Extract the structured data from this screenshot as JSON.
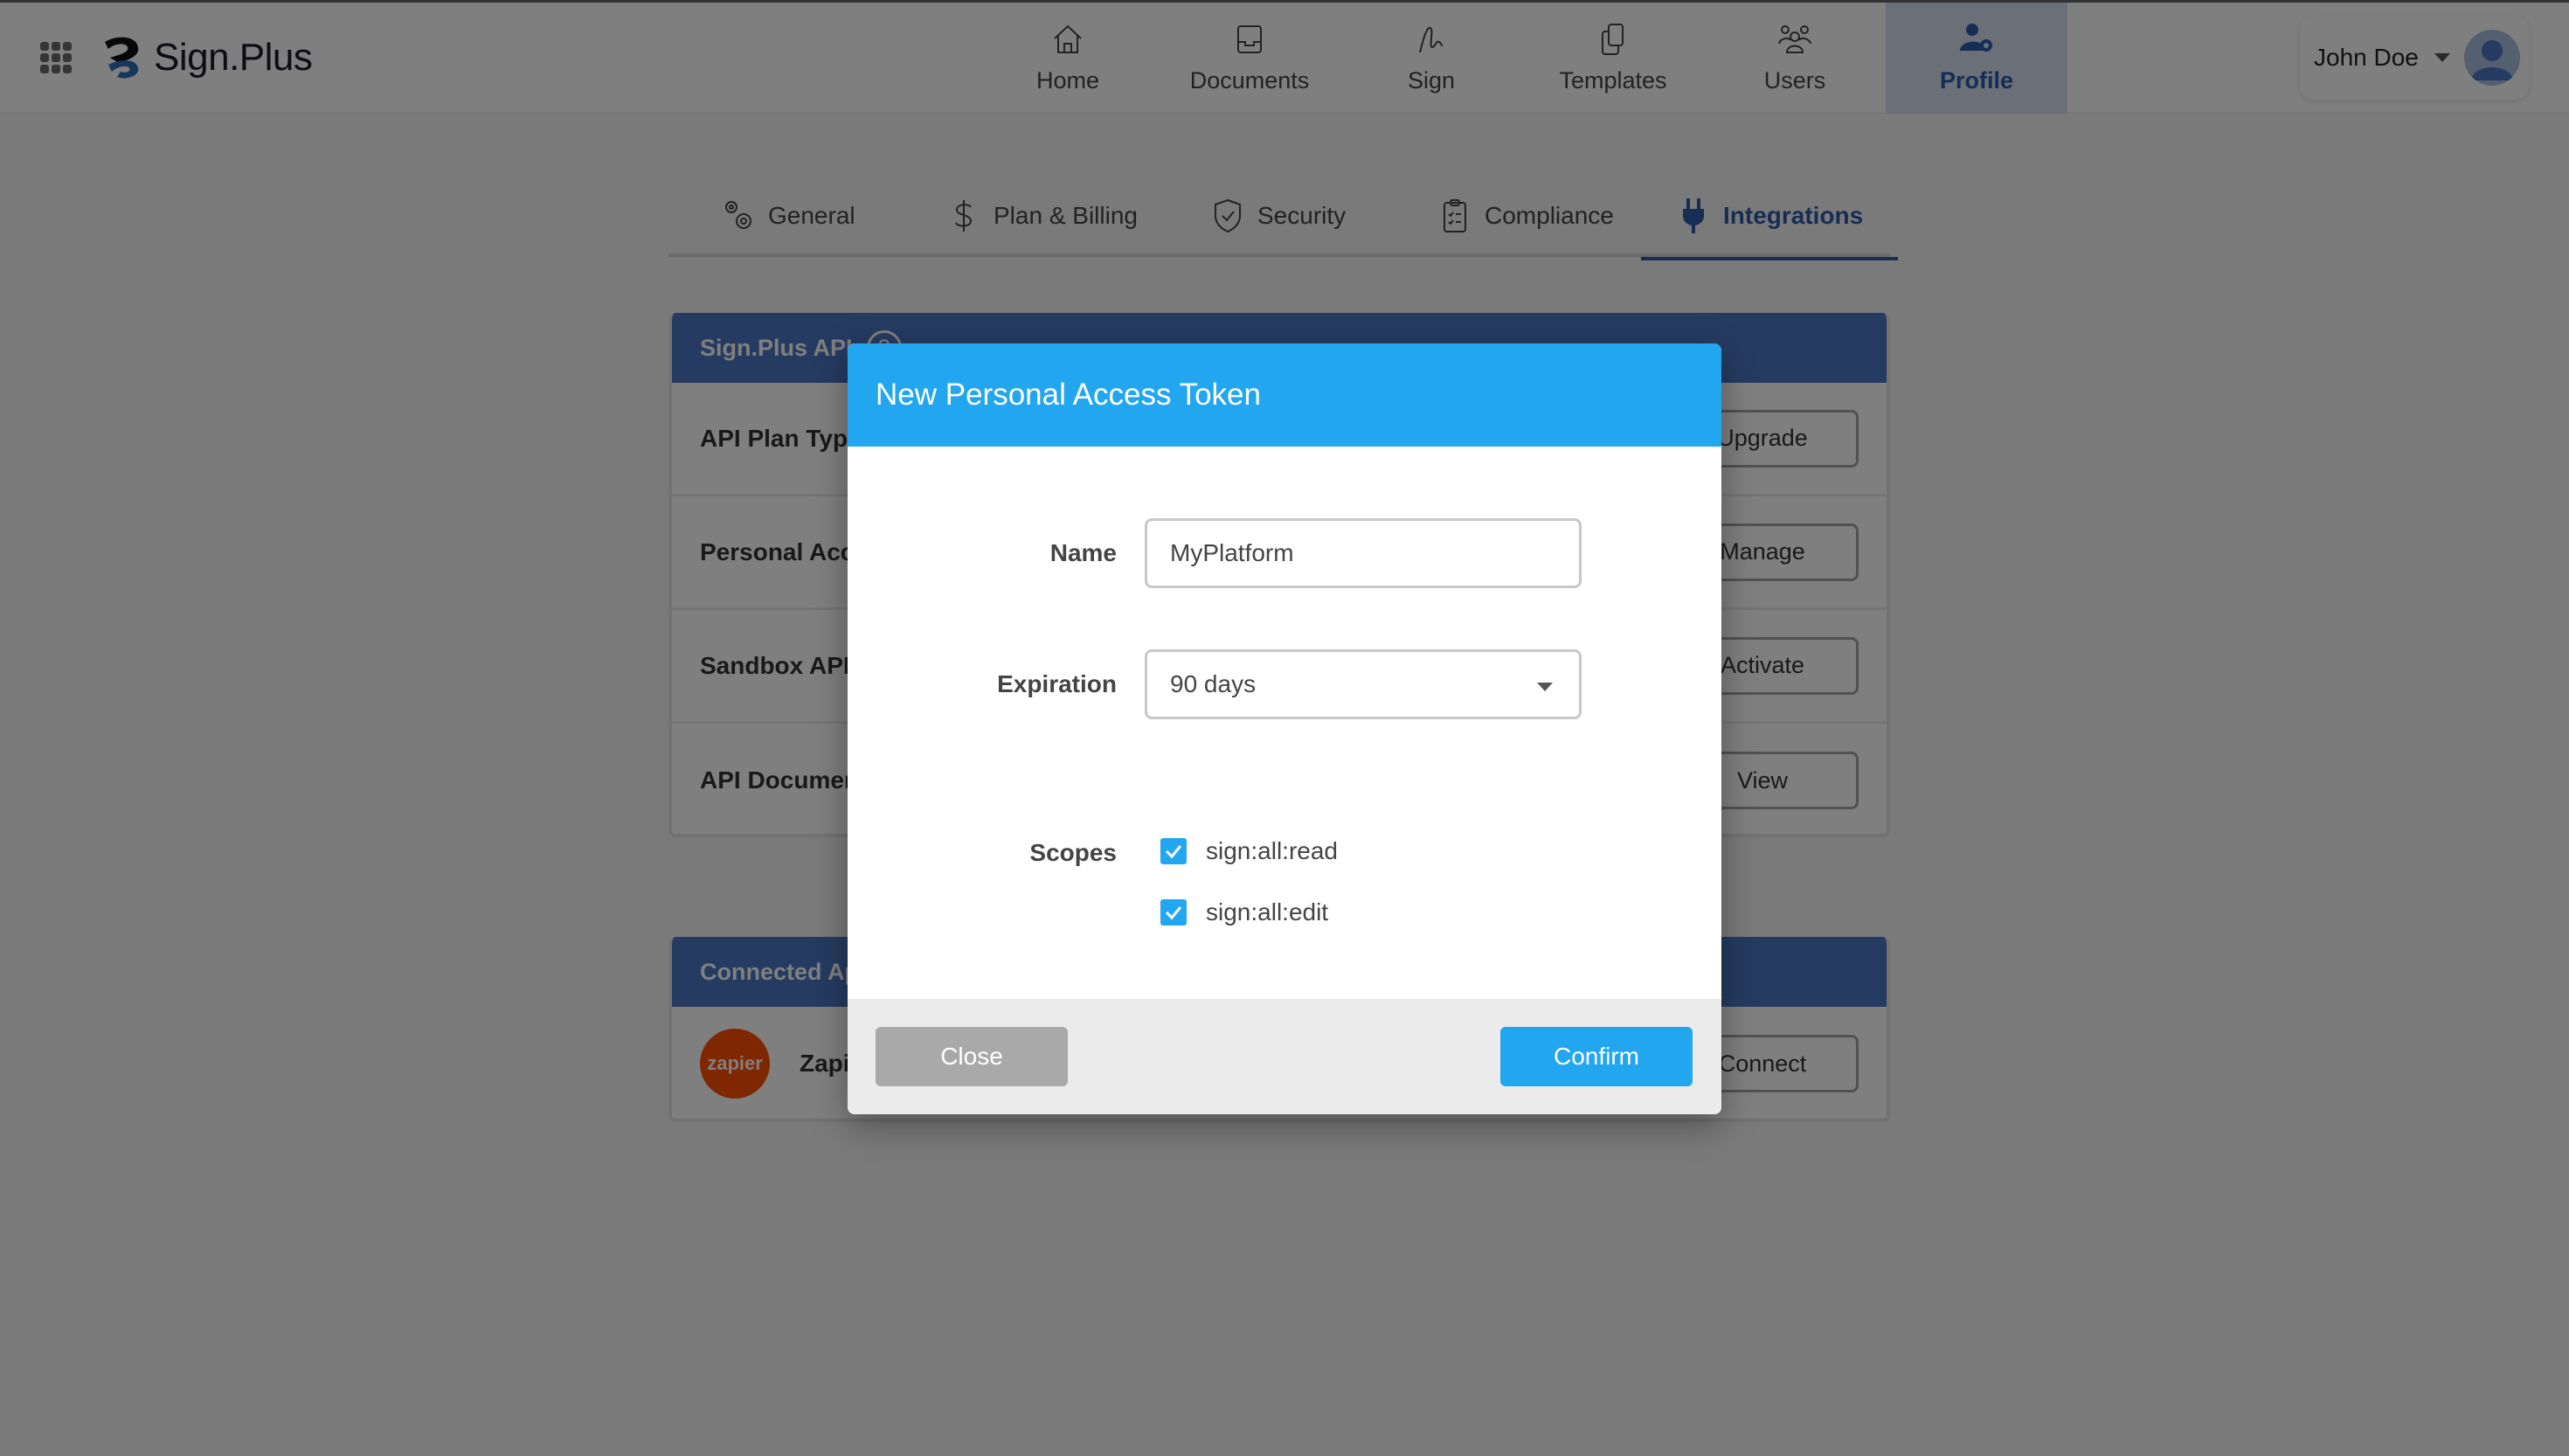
{
  "app": {
    "brand": "Sign.Plus"
  },
  "nav": {
    "items": [
      {
        "label": "Home",
        "icon": "home-icon",
        "active": false
      },
      {
        "label": "Documents",
        "icon": "inbox-tray-icon",
        "active": false
      },
      {
        "label": "Sign",
        "icon": "signature-icon",
        "active": false
      },
      {
        "label": "Templates",
        "icon": "copy-icon",
        "active": false
      },
      {
        "label": "Users",
        "icon": "users-group-icon",
        "active": false
      },
      {
        "label": "Profile",
        "icon": "user-gear-icon",
        "active": true
      }
    ]
  },
  "user": {
    "name": "John Doe"
  },
  "subtabs": [
    {
      "label": "General",
      "icon": "gears-icon",
      "active": false
    },
    {
      "label": "Plan & Billing",
      "icon": "dollar-icon",
      "active": false
    },
    {
      "label": "Security",
      "icon": "shield-check-icon",
      "active": false
    },
    {
      "label": "Compliance",
      "icon": "clipboard-check-icon",
      "active": false
    },
    {
      "label": "Integrations",
      "icon": "plug-icon",
      "active": true
    }
  ],
  "api_card": {
    "title": "Sign.Plus API",
    "rows": [
      {
        "label": "API Plan Type",
        "button": "Upgrade"
      },
      {
        "label": "Personal Access Tokens",
        "button": "Manage"
      },
      {
        "label": "Sandbox API",
        "button": "Activate"
      },
      {
        "label": "API Documentation",
        "button": "View"
      }
    ]
  },
  "apps_card": {
    "title": "Connected Apps",
    "rows": [
      {
        "logo_text": "zapier",
        "label": "Zapier",
        "button": "Connect"
      }
    ]
  },
  "modal": {
    "title": "New Personal Access Token",
    "name_label": "Name",
    "name_value": "MyPlatform",
    "expiration_label": "Expiration",
    "expiration_value": "90 days",
    "scopes_label": "Scopes",
    "scopes": [
      {
        "label": "sign:all:read",
        "checked": true
      },
      {
        "label": "sign:all:edit",
        "checked": true
      }
    ],
    "close_label": "Close",
    "confirm_label": "Confirm"
  },
  "colors": {
    "primary": "#23a6f0",
    "brand_dark": "#2e5aa6",
    "card_header": "#4a76c2",
    "zapier": "#ff4f00"
  }
}
